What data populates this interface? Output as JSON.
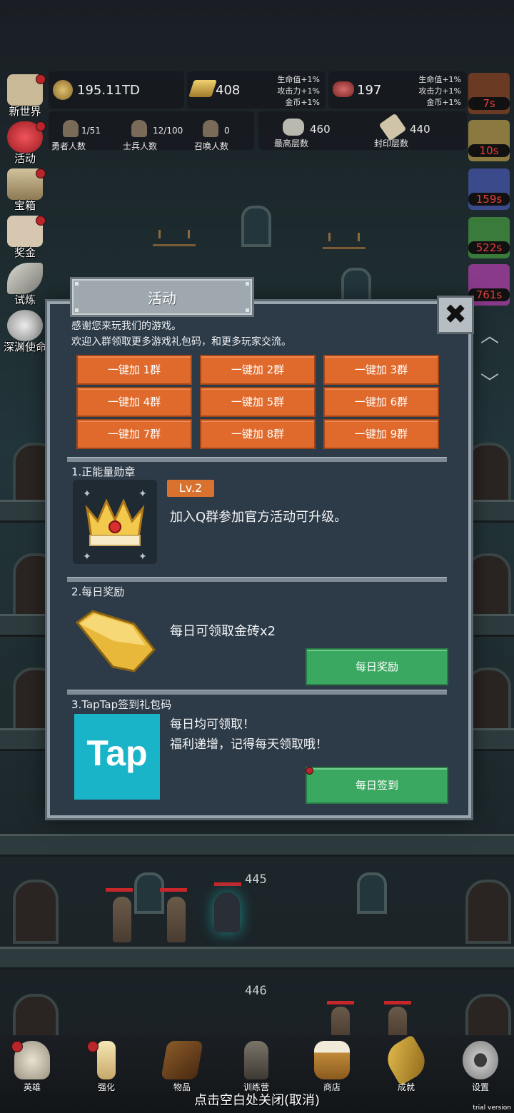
{
  "resources": {
    "gold": "195.11TD",
    "gold_bar": "408",
    "gold_bar_bonus": [
      "生命值+1%",
      "攻击力+1%",
      "金币+1%"
    ],
    "meat": "197",
    "meat_bonus": [
      "生命值+1%",
      "攻击力+1%",
      "金币+1%"
    ]
  },
  "stats": [
    {
      "value": "1/51",
      "label": "勇者人数"
    },
    {
      "value": "12/100",
      "label": "士兵人数"
    },
    {
      "value": "0",
      "label": "召唤人数"
    },
    {
      "value": "460",
      "label": "最高层数"
    },
    {
      "value": "440",
      "label": "封印层数"
    }
  ],
  "side_menu": [
    "新世界",
    "活动",
    "宝箱",
    "奖金",
    "试炼",
    "深渊使命"
  ],
  "timers": [
    "7s",
    "10s",
    "159s",
    "522s",
    "761s"
  ],
  "floors": [
    "445",
    "446"
  ],
  "modal": {
    "title": "活动",
    "close": "✖",
    "intro": [
      "感谢您来玩我们的游戏。",
      "欢迎入群领取更多游戏礼包码，和更多玩家交流。"
    ],
    "group_buttons": [
      "一键加 1群",
      "一键加 2群",
      "一键加 3群",
      "一键加 4群",
      "一键加 5群",
      "一键加 6群",
      "一键加 7群",
      "一键加 8群",
      "一键加 9群"
    ],
    "section1": {
      "title": "1.正能量勋章",
      "level": "Lv.2",
      "text": "加入Q群参加官方活动可升级。"
    },
    "section2": {
      "title": "2.每日奖励",
      "text": "每日可领取金砖x2",
      "button": "每日奖励"
    },
    "section3": {
      "title": "3.TapTap签到礼包码",
      "logo": "Tap",
      "line1": "每日均可领取！",
      "line2": "福利递增，记得每天领取哦！",
      "button": "每日签到"
    }
  },
  "bottom_nav": [
    "英雄",
    "强化",
    "物品",
    "训练营",
    "商店",
    "成就",
    "设置"
  ],
  "close_hint": "点击空白处关闭(取消)",
  "watermark": "trial version"
}
